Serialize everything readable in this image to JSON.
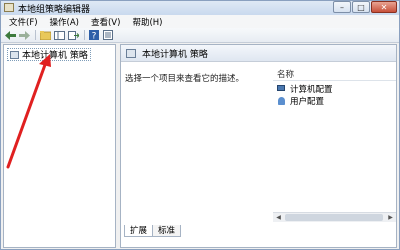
{
  "window": {
    "title": "本地组策略编辑器",
    "controls": [
      "–",
      "□",
      "✕"
    ]
  },
  "menu": [
    "文件(F)",
    "操作(A)",
    "查看(V)",
    "帮助(H)"
  ],
  "toolbar": {
    "icons": [
      "back-arrow-icon",
      "forward-arrow-icon",
      "folder-icon",
      "show-hide-tree-icon",
      "export-list-icon",
      "help-icon",
      "properties-icon"
    ]
  },
  "tree": {
    "root_label": "本地计算机 策略"
  },
  "details": {
    "header_title": "本地计算机 策略",
    "description": "选择一个项目来查看它的描述。",
    "column_header": "名称",
    "items": [
      {
        "label": "计算机配置",
        "icon": "computer-config-icon"
      },
      {
        "label": "用户配置",
        "icon": "user-config-icon"
      }
    ]
  },
  "tabs": [
    "扩展",
    "标准"
  ],
  "colors": {
    "annotation_arrow": "#e02020",
    "accent_blue": "#4a78b0"
  }
}
